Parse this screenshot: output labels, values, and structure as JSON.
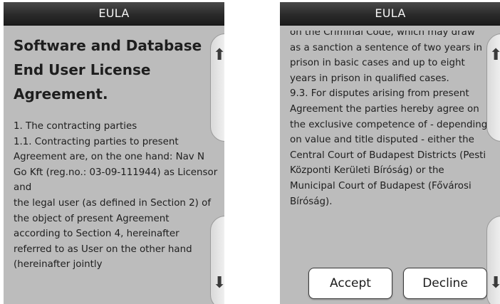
{
  "left_screen": {
    "title": "EULA",
    "doc_title": "Software and Database\nEnd User License\nAgreement.",
    "body": "1. The contracting parties\n1.1. Contracting parties to present Agreement are, on the one hand: Nav N Go Kft (reg.no.: 03-09-111944) as Licensor\nand\nthe legal user (as defined in Section 2) of the object of present Agreement according to Section 4, hereinafter referred to as User on the other hand (hereinafter jointly"
  },
  "right_screen": {
    "title": "EULA",
    "body": "on the Criminal Code, which may draw as a sanction a sentence of two years in prison in basic cases and up to eight years in prison in qualified cases.\n9.3. For disputes arising from present Agreement the parties hereby agree on the exclusive competence of - depending on value and title disputed - either the Central Court of Budapest Districts (Pesti Központi Kerületi Bíróság) or the Municipal Court of Budapest (Fővárosi Bíróság).",
    "accept_label": "Accept",
    "decline_label": "Decline"
  },
  "icons": {
    "scroll_up": "up-arrow-icon",
    "scroll_down": "down-arrow-icon"
  }
}
